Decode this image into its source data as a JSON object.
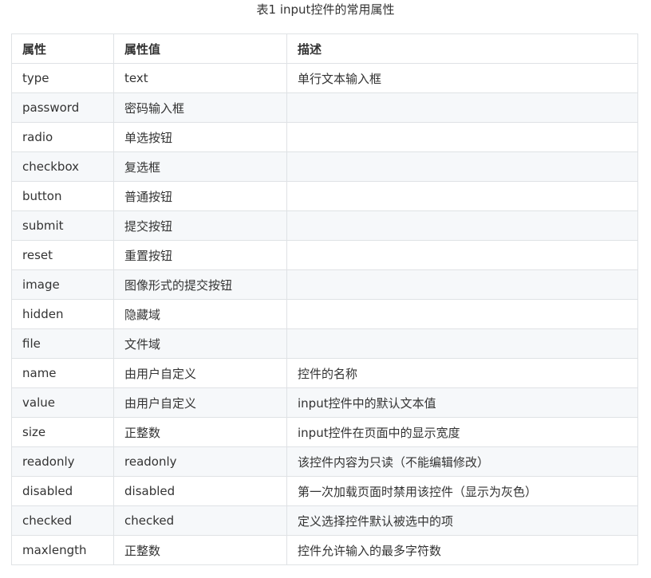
{
  "caption": "表1 input控件的常用属性",
  "table": {
    "headers": [
      "属性",
      "属性值",
      "描述"
    ],
    "rows": [
      [
        "type",
        "text",
        "单行文本输入框"
      ],
      [
        "password",
        "密码输入框",
        ""
      ],
      [
        "radio",
        "单选按钮",
        ""
      ],
      [
        "checkbox",
        "复选框",
        ""
      ],
      [
        "button",
        "普通按钮",
        ""
      ],
      [
        "submit",
        "提交按钮",
        ""
      ],
      [
        "reset",
        "重置按钮",
        ""
      ],
      [
        "image",
        "图像形式的提交按钮",
        ""
      ],
      [
        "hidden",
        "隐藏域",
        ""
      ],
      [
        "file",
        "文件域",
        ""
      ],
      [
        "name",
        "由用户自定义",
        "控件的名称"
      ],
      [
        "value",
        "由用户自定义",
        "input控件中的默认文本值"
      ],
      [
        "size",
        "正整数",
        "input控件在页面中的显示宽度"
      ],
      [
        "readonly",
        "readonly",
        "该控件内容为只读（不能编辑修改）"
      ],
      [
        "disabled",
        "disabled",
        "第一次加载页面时禁用该控件（显示为灰色）"
      ],
      [
        "checked",
        "checked",
        "定义选择控件默认被选中的项"
      ],
      [
        "maxlength",
        "正整数",
        "控件允许输入的最多字符数"
      ]
    ]
  }
}
